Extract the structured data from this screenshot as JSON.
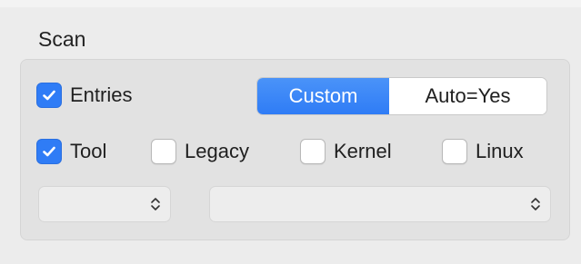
{
  "section": {
    "title": "Scan"
  },
  "entries_checkbox": {
    "label": "Entries",
    "checked": true
  },
  "mode_segmented": {
    "options": [
      "Custom",
      "Auto=Yes"
    ],
    "selected": "Custom"
  },
  "options_row": [
    {
      "label": "Tool",
      "checked": true
    },
    {
      "label": "Legacy",
      "checked": false
    },
    {
      "label": "Kernel",
      "checked": false
    },
    {
      "label": "Linux",
      "checked": false
    }
  ],
  "popups": [
    {
      "value": "",
      "icon": "chevron-up-down-icon"
    },
    {
      "value": "",
      "icon": "chevron-up-down-icon"
    }
  ],
  "colors": {
    "accent": "#2f7cf6",
    "group_background": "#e2e2e2",
    "window_background": "#ececec"
  }
}
